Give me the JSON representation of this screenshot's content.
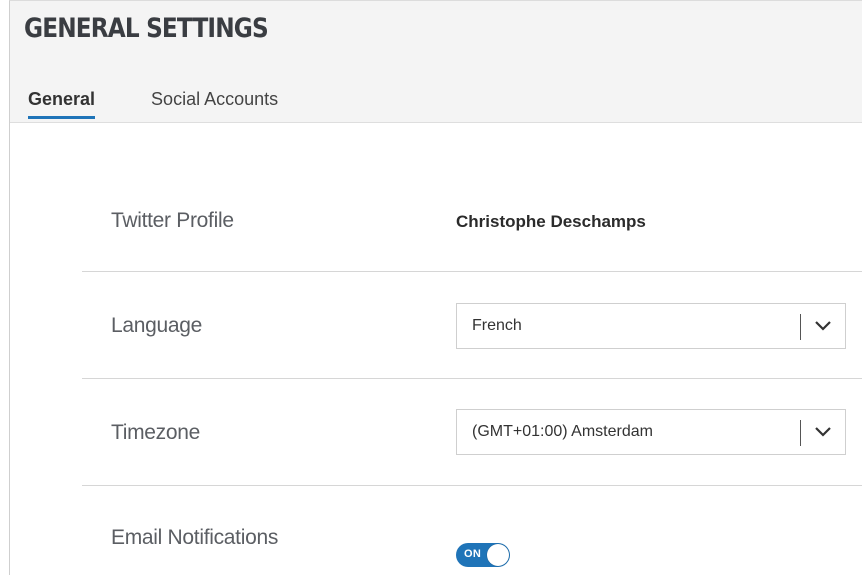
{
  "page": {
    "title": "GENERAL SETTINGS"
  },
  "tabs": [
    {
      "label": "General",
      "active": true
    },
    {
      "label": "Social Accounts",
      "active": false
    }
  ],
  "settings": {
    "twitter_profile": {
      "label": "Twitter Profile",
      "value": "Christophe Deschamps"
    },
    "language": {
      "label": "Language",
      "selected": "French",
      "icon": "chevron-down-icon"
    },
    "timezone": {
      "label": "Timezone",
      "selected": "(GMT+01:00) Amsterdam",
      "icon": "chevron-down-icon"
    },
    "email_notifications": {
      "label": "Email Notifications",
      "toggle_text": "ON",
      "enabled": true
    }
  },
  "colors": {
    "accent": "#1f74b8",
    "header_bg": "#f4f4f4",
    "title_text": "#3a3d42",
    "label_text": "#5b5e63"
  }
}
